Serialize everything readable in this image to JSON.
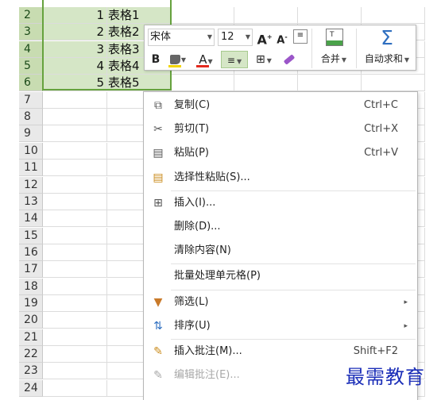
{
  "rows": [
    {
      "num": "2",
      "a": "1",
      "b": "表格1",
      "selected": true
    },
    {
      "num": "3",
      "a": "2",
      "b": "表格2",
      "selected": true
    },
    {
      "num": "4",
      "a": "3",
      "b": "表格3",
      "selected": true
    },
    {
      "num": "5",
      "a": "4",
      "b": "表格4",
      "selected": true
    },
    {
      "num": "6",
      "a": "5",
      "b": "表格5",
      "selected": true
    },
    {
      "num": "7"
    },
    {
      "num": "8"
    },
    {
      "num": "9"
    },
    {
      "num": "10"
    },
    {
      "num": "11"
    },
    {
      "num": "12"
    },
    {
      "num": "13"
    },
    {
      "num": "14"
    },
    {
      "num": "15"
    },
    {
      "num": "16"
    },
    {
      "num": "17"
    },
    {
      "num": "18"
    },
    {
      "num": "19"
    },
    {
      "num": "20"
    },
    {
      "num": "21"
    },
    {
      "num": "22"
    },
    {
      "num": "23"
    },
    {
      "num": "24"
    }
  ],
  "mini_toolbar": {
    "font_name": "宋体",
    "font_size": "12",
    "merge_label": "合并",
    "autosum_label": "自动求和",
    "bold": "B",
    "font_color_letter": "A",
    "grow_font": "A",
    "shrink_font": "A"
  },
  "context_menu": {
    "items": [
      {
        "icon": "copy-icon",
        "label": "复制(C)",
        "shortcut": "Ctrl+C"
      },
      {
        "icon": "cut-icon",
        "label": "剪切(T)",
        "shortcut": "Ctrl+X"
      },
      {
        "icon": "paste-icon",
        "label": "粘贴(P)",
        "shortcut": "Ctrl+V"
      },
      {
        "icon": "paste-special-icon",
        "label": "选择性粘贴(S)...",
        "shortcut": ""
      },
      {
        "icon": "insert-icon",
        "label": "插入(I)...",
        "shortcut": ""
      },
      {
        "icon": "",
        "label": "删除(D)...",
        "shortcut": ""
      },
      {
        "icon": "",
        "label": "清除内容(N)",
        "shortcut": ""
      },
      {
        "icon": "",
        "label": "批量处理单元格(P)",
        "shortcut": ""
      },
      {
        "icon": "filter-icon",
        "label": "筛选(L)",
        "shortcut": "",
        "submenu": true
      },
      {
        "icon": "sort-icon",
        "label": "排序(U)",
        "shortcut": "",
        "submenu": true
      },
      {
        "icon": "insert-comment-icon",
        "label": "插入批注(M)...",
        "shortcut": "Shift+F2"
      },
      {
        "icon": "edit-comment-icon",
        "label": "编辑批注(E)...",
        "shortcut": "",
        "disabled": true
      }
    ]
  },
  "watermark": "最需教育",
  "colors": {
    "selection_border": "#66a23e",
    "selection_fill": "#d5e6c6",
    "selected_header": "#c8dcb1",
    "watermark": "#1c2fb8",
    "autosum_icon": "#2f6fc0"
  }
}
